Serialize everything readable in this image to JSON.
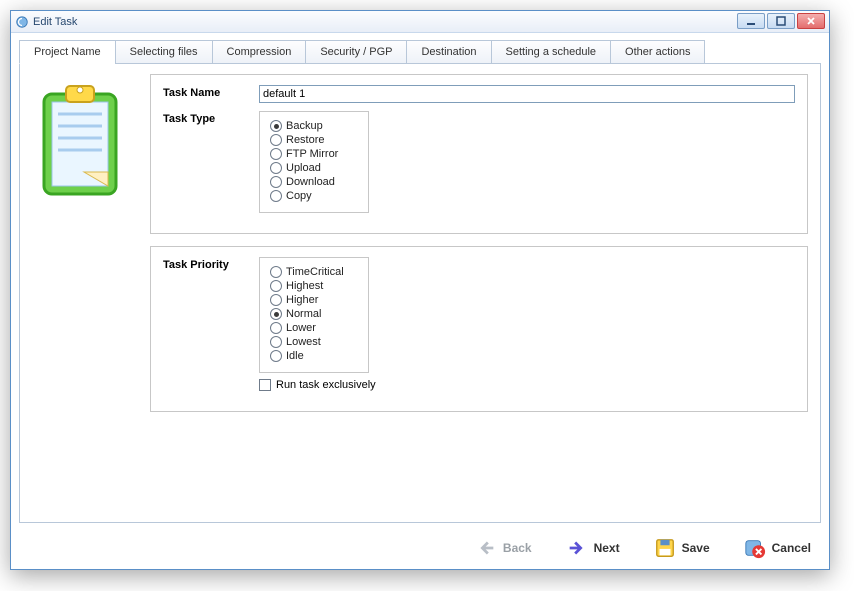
{
  "window": {
    "title": "Edit Task"
  },
  "tabs": [
    {
      "label": "Project Name",
      "active": true
    },
    {
      "label": "Selecting files"
    },
    {
      "label": "Compression"
    },
    {
      "label": "Security / PGP"
    },
    {
      "label": "Destination"
    },
    {
      "label": "Setting a schedule"
    },
    {
      "label": "Other actions"
    }
  ],
  "group1": {
    "taskNameLabel": "Task Name",
    "taskNameValue": "default 1",
    "taskTypeLabel": "Task Type",
    "taskTypes": [
      {
        "label": "Backup",
        "selected": true
      },
      {
        "label": "Restore"
      },
      {
        "label": "FTP Mirror"
      },
      {
        "label": "Upload"
      },
      {
        "label": "Download"
      },
      {
        "label": "Copy"
      }
    ]
  },
  "group2": {
    "priorityLabel": "Task Priority",
    "priorities": [
      {
        "label": "TimeCritical"
      },
      {
        "label": "Highest"
      },
      {
        "label": "Higher"
      },
      {
        "label": "Normal",
        "selected": true
      },
      {
        "label": "Lower"
      },
      {
        "label": "Lowest"
      },
      {
        "label": "Idle"
      }
    ],
    "exclusiveLabel": "Run task exclusively",
    "exclusiveChecked": false
  },
  "footer": {
    "back": "Back",
    "next": "Next",
    "save": "Save",
    "cancel": "Cancel"
  }
}
